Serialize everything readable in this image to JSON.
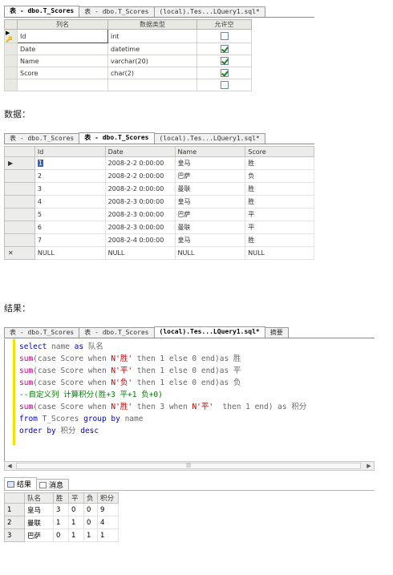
{
  "design": {
    "tabs": [
      "表 - dbo.T_Scores",
      "表 - dbo.T_Scores",
      "(local).Tes...LQuery1.sql*"
    ],
    "columns": [
      "列名",
      "数据类型",
      "允许空"
    ],
    "rows": [
      {
        "marker": "▶🔑",
        "name": "Id",
        "type": "int",
        "nullable": false
      },
      {
        "marker": "",
        "name": "Date",
        "type": "datetime",
        "nullable": true
      },
      {
        "marker": "",
        "name": "Name",
        "type": "varchar(20)",
        "nullable": true
      },
      {
        "marker": "",
        "name": "Score",
        "type": "char(2)",
        "nullable": true
      },
      {
        "marker": "",
        "name": "",
        "type": "",
        "nullable": false
      }
    ]
  },
  "label_data": "数据：",
  "results": {
    "tabs": [
      "表 - dbo.T_Scores",
      "表 - dbo.T_Scores",
      "(local).Tes...LQuery1.sql*"
    ],
    "columns": [
      "Id",
      "Date",
      "Name",
      "Score"
    ],
    "rows": [
      {
        "marker": "▶",
        "id": "1",
        "date": "2008-2-2 0:00:00",
        "name": "皇马",
        "score": "胜"
      },
      {
        "marker": "",
        "id": "2",
        "date": "2008-2-2 0:00:00",
        "name": "巴萨",
        "score": "负"
      },
      {
        "marker": "",
        "id": "3",
        "date": "2008-2-2 0:00:00",
        "name": "曼联",
        "score": "胜"
      },
      {
        "marker": "",
        "id": "4",
        "date": "2008-2-3 0:00:00",
        "name": "皇马",
        "score": "胜"
      },
      {
        "marker": "",
        "id": "5",
        "date": "2008-2-3 0:00:00",
        "name": "巴萨",
        "score": "平"
      },
      {
        "marker": "",
        "id": "6",
        "date": "2008-2-3 0:00:00",
        "name": "曼联",
        "score": "平"
      },
      {
        "marker": "",
        "id": "7",
        "date": "2008-2-4 0:00:00",
        "name": "皇马",
        "score": "胜"
      },
      {
        "marker": "✕",
        "id": "NULL",
        "date": "NULL",
        "name": "NULL",
        "score": "NULL"
      }
    ]
  },
  "label_result": "结果：",
  "editor": {
    "tabs": [
      "表 - dbo.T_Scores",
      "表 - dbo.T_Scores",
      "(local).Tes...LQuery1.sql*",
      "摘要"
    ],
    "code": {
      "l1_kw1": "select",
      "l1_col": " name ",
      "l1_kw2": "as",
      "l1_alias": " 队名",
      "l2_fn": "sum",
      "l2_a": "(case Score when ",
      "l2_str": "N'胜'",
      "l2_b": " then 1 else 0 end)as ",
      "l2_alias": "胜",
      "l3_fn": "sum",
      "l3_a": "(case Score when ",
      "l3_str": "N'平'",
      "l3_b": " then 1 else 0 end)as ",
      "l3_alias": "平",
      "l4_fn": "sum",
      "l4_a": "(case Score when ",
      "l4_str": "N'负'",
      "l4_b": " then 1 else 0 end)as ",
      "l4_alias": "负",
      "l5_comment": "--自定义列 计算积分(胜+3 平+1 负+0)",
      "l6_fn": "sum",
      "l6_a": "(case Score when ",
      "l6_str": "N'胜'",
      "l6_b": " then 3 when ",
      "l6_str2": "N'平'",
      "l6_c": "  then 1 end) as 积分",
      "l7_kw1": "from",
      "l7_a": " T_Scores ",
      "l7_kw2": "group by",
      "l7_b": " name",
      "l8_kw1": "order by",
      "l8_a": " 积分 ",
      "l8_kw2": "desc"
    }
  },
  "result_tabs": {
    "results": "结果",
    "messages": "消息"
  },
  "result_grid": {
    "columns": [
      "队名",
      "胜",
      "平",
      "负",
      "积分"
    ],
    "rows": [
      {
        "n": "1",
        "team": "皇马",
        "win": "3",
        "draw": "0",
        "loss": "0",
        "pts": "9"
      },
      {
        "n": "2",
        "team": "曼联",
        "win": "1",
        "draw": "1",
        "loss": "0",
        "pts": "4"
      },
      {
        "n": "3",
        "team": "巴萨",
        "win": "0",
        "draw": "1",
        "loss": "1",
        "pts": "1"
      }
    ]
  }
}
